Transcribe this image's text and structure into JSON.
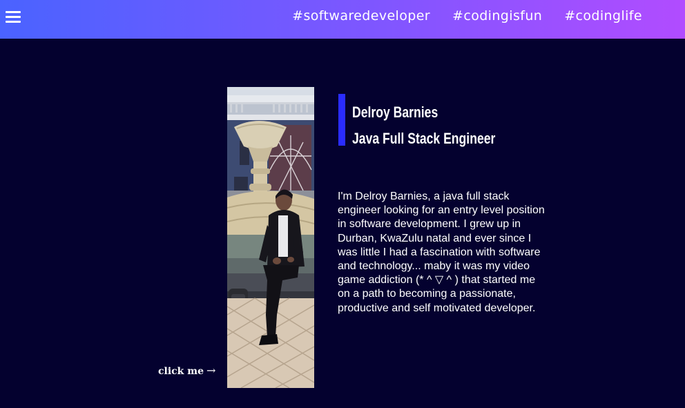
{
  "header": {
    "tags": [
      "#softwaredeveloper",
      "#codingisfun",
      "#codinglife"
    ]
  },
  "profile": {
    "name": "Delroy Barnies",
    "role": "Java Full Stack Engineer",
    "bio": "I'm Delroy Barnies, a java full stack engineer looking for an entry level position in software development. I grew up in Durban, KwaZulu natal and ever since I was little I had a fascination with software and technology... maby it was my video game addiction (* ^ ▽ ^ ) that started me on a path to becoming a passionate, productive and self motivated developer."
  },
  "cta": {
    "label": "click me",
    "arrow": "→"
  },
  "colors": {
    "background": "#04012f",
    "header_gradient_start": "#4a63ff",
    "header_gradient_end": "#b14cff",
    "accent_bar": "#2a2cff"
  },
  "icons": {
    "menu": "hamburger-menu-icon",
    "cta_arrow": "right-arrow-icon"
  }
}
